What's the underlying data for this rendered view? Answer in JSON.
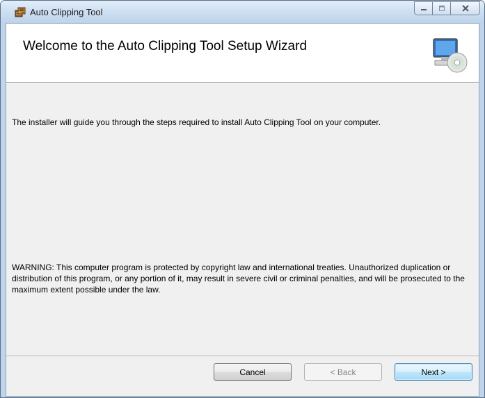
{
  "window": {
    "title": "Auto Clipping Tool",
    "icons": {
      "app": "installer-box-icon",
      "minimize": "minimize-icon",
      "maximize": "maximize-icon",
      "close": "close-icon"
    }
  },
  "banner": {
    "title": "Welcome to the Auto Clipping Tool Setup Wizard",
    "icon": "computer-cd-icon"
  },
  "body": {
    "intro": "The installer will guide you through the steps required to install Auto Clipping Tool on your computer.",
    "warning": "WARNING: This computer program is protected by copyright law and international treaties. Unauthorized duplication or distribution of this program, or any portion of it, may result in severe civil or criminal penalties, and will be prosecuted to the maximum extent possible under the law."
  },
  "buttons": {
    "cancel": "Cancel",
    "back": "< Back",
    "next": "Next >"
  },
  "colors": {
    "titlebar": "#cfe0f2",
    "client": "#f0f0f0",
    "next_border": "#3c7fb1"
  }
}
